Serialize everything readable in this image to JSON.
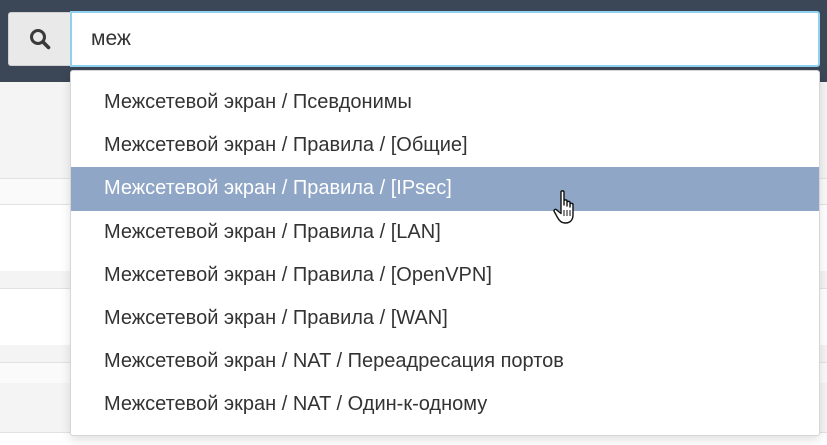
{
  "search": {
    "value": "меж",
    "icon": "search-icon"
  },
  "suggestions": [
    {
      "label": "Межсетевой экран / Псевдонимы",
      "active": false
    },
    {
      "label": "Межсетевой экран / Правила / [Общие]",
      "active": false
    },
    {
      "label": "Межсетевой экран / Правила / [IPsec]",
      "active": true
    },
    {
      "label": "Межсетевой экран / Правила / [LAN]",
      "active": false
    },
    {
      "label": "Межсетевой экран / Правила / [OpenVPN]",
      "active": false
    },
    {
      "label": "Межсетевой экран / Правила / [WAN]",
      "active": false
    },
    {
      "label": "Межсетевой экран / NAT / Переадресация портов",
      "active": false
    },
    {
      "label": "Межсетевой экран / NAT / Один-к-одному",
      "active": false
    }
  ],
  "colors": {
    "topbar": "#3b4656",
    "input_focus_border": "#8fd1ef",
    "highlight": "#8fa6c7"
  }
}
